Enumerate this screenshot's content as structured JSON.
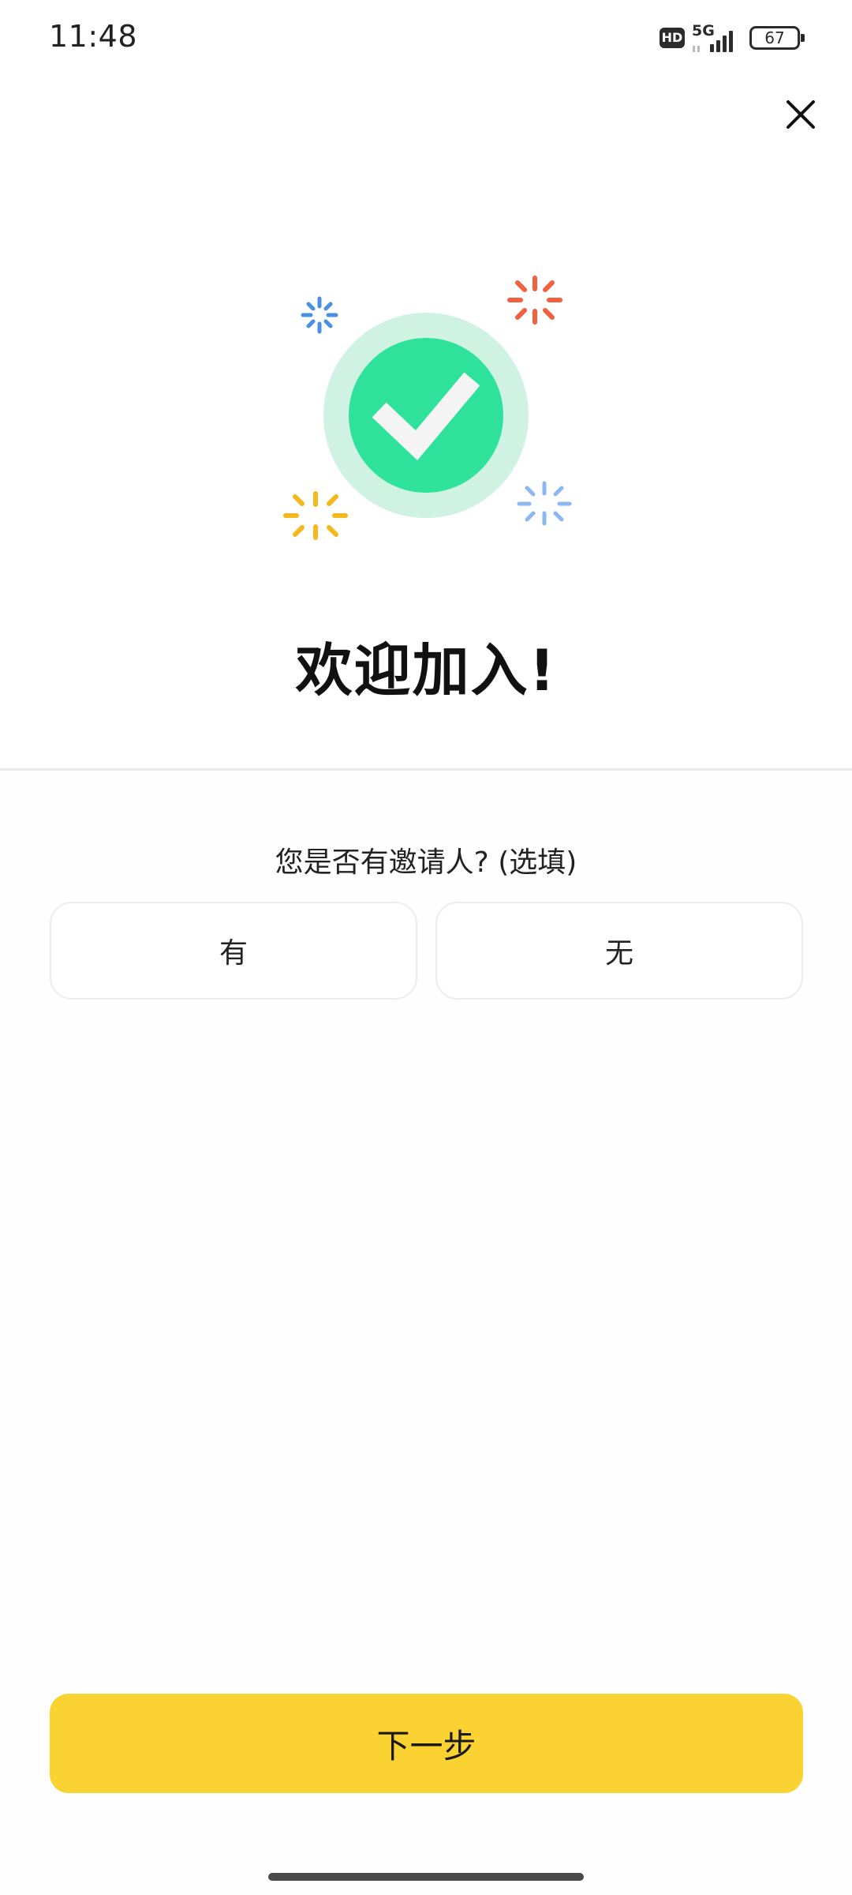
{
  "status_bar": {
    "time": "11:48",
    "hd_label": "HD",
    "network": "5G",
    "battery_level": "67"
  },
  "close": {
    "icon": "close-icon"
  },
  "illustration": {
    "icon": "check-circle-icon",
    "colors": {
      "check_inner": "#2ee29c",
      "check_outer": "#cff2e3",
      "sparkle_orange": "#f2603f",
      "sparkle_blue": "#4a90e2",
      "sparkle_yellow": "#f4b71c",
      "sparkle_light_blue": "#8bb8f0"
    }
  },
  "welcome": {
    "title": "欢迎加入!"
  },
  "inviter": {
    "question": "您是否有邀请人? (选填)",
    "options": [
      {
        "label": "有"
      },
      {
        "label": "无"
      }
    ]
  },
  "footer": {
    "next_label": "下一步",
    "next_color": "#fad232"
  }
}
